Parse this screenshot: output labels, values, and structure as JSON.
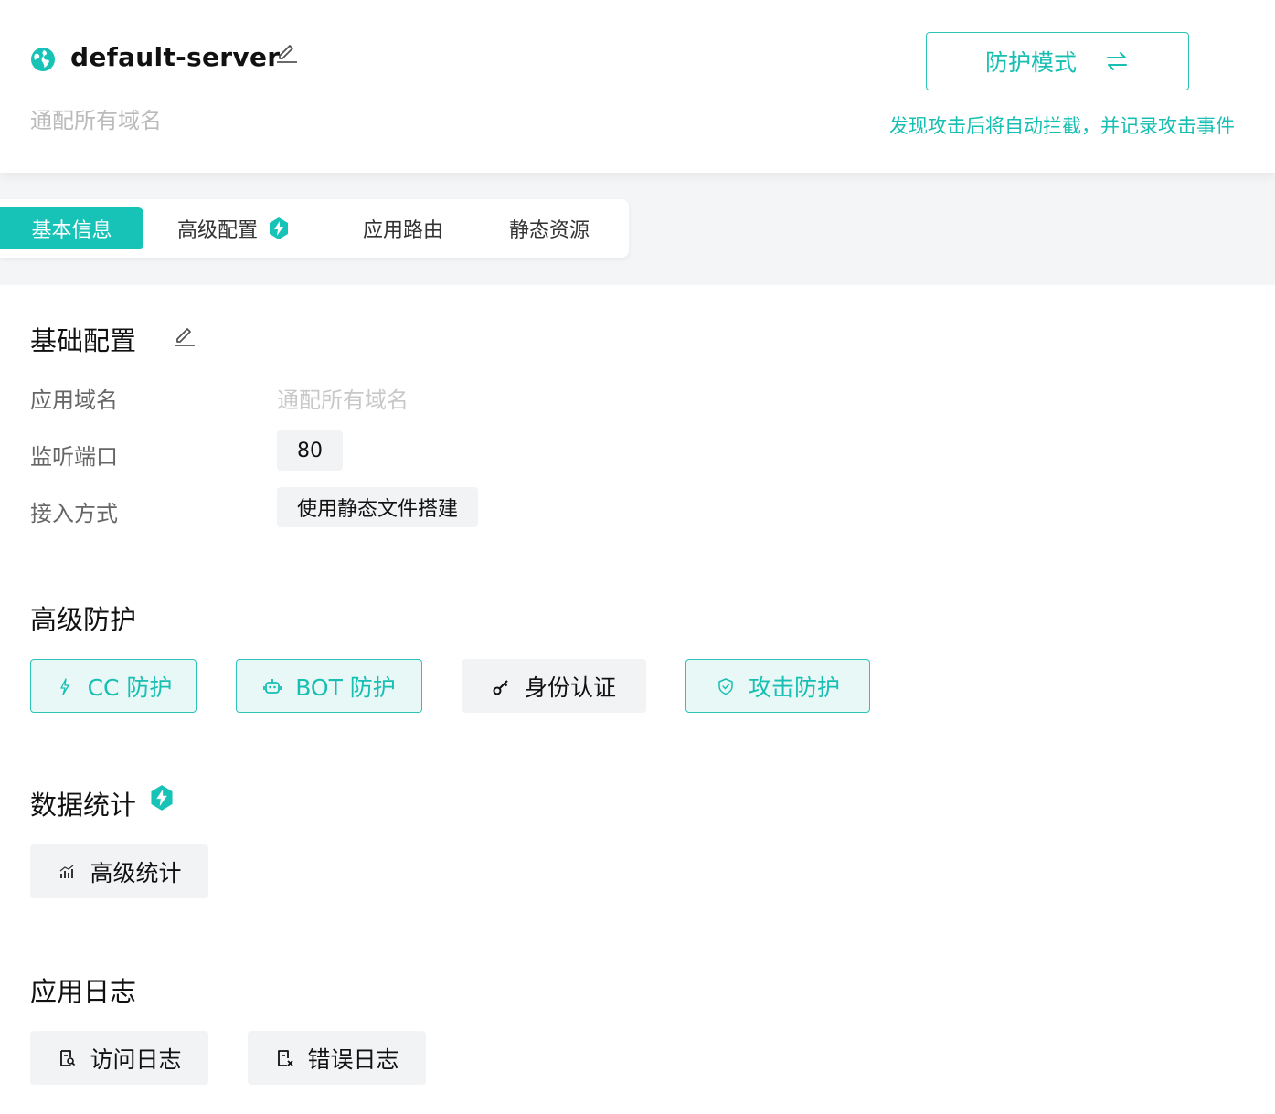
{
  "header": {
    "server_name": "default-server",
    "server_subtitle": "通配所有域名",
    "mode_button_label": "防护模式",
    "mode_description": "发现攻击后将自动拦截，并记录攻击事件"
  },
  "tabs": [
    {
      "label": "基本信息",
      "active": true
    },
    {
      "label": "高级配置",
      "active": false,
      "badge": "pro-badge-icon"
    },
    {
      "label": "应用路由",
      "active": false
    },
    {
      "label": "静态资源",
      "active": false
    }
  ],
  "basic_config": {
    "title": "基础配置",
    "fields": [
      {
        "label": "应用域名",
        "value": "通配所有域名"
      },
      {
        "label": "监听端口",
        "value": "80"
      },
      {
        "label": "接入方式",
        "value": "使用静态文件搭建"
      }
    ]
  },
  "advanced_protection": {
    "title": "高级防护",
    "buttons": [
      {
        "label": "CC 防护",
        "icon": "lightning-icon",
        "state": "enabled"
      },
      {
        "label": "BOT 防护",
        "icon": "robot-icon",
        "state": "enabled"
      },
      {
        "label": "身份认证",
        "icon": "key-icon",
        "state": "disabled"
      },
      {
        "label": "攻击防护",
        "icon": "shield-icon",
        "state": "enabled"
      }
    ]
  },
  "data_stats": {
    "title": "数据统计",
    "buttons": [
      {
        "label": "高级统计",
        "icon": "bar-chart-icon"
      }
    ]
  },
  "app_logs": {
    "title": "应用日志",
    "buttons": [
      {
        "label": "访问日志",
        "icon": "document-search-icon"
      },
      {
        "label": "错误日志",
        "icon": "document-error-icon"
      }
    ]
  },
  "colors": {
    "accent": "#17c2b6",
    "accent_border": "#2cc4b8",
    "accent_bg": "#e8f8f7",
    "muted_text": "#bbbbbb",
    "chip_bg": "#f2f3f5",
    "band_bg": "#f4f5f7"
  }
}
